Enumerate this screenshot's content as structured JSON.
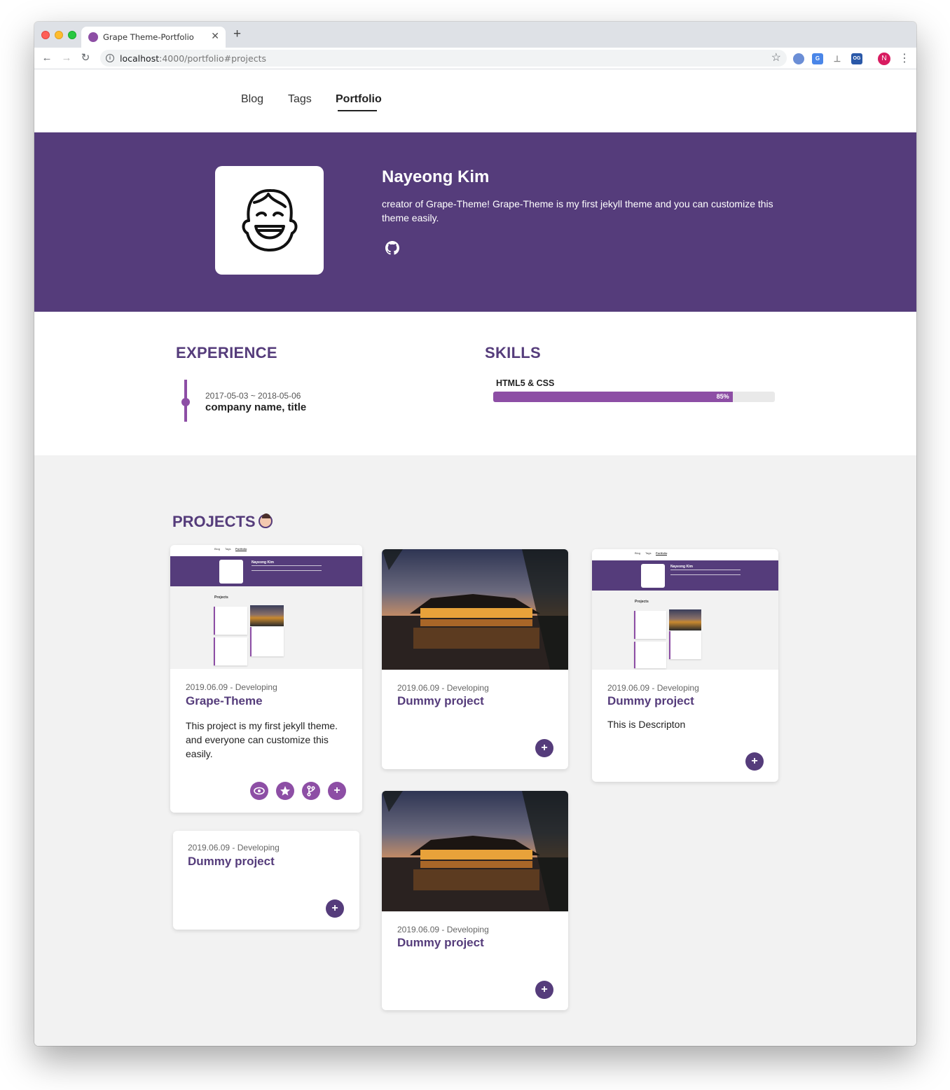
{
  "browser": {
    "tab_title": "Grape Theme-Portfolio",
    "new_tab": "+",
    "url_host": "localhost",
    "url_path": ":4000/portfolio#projects",
    "profile_initial": "N",
    "ext_og": "OG"
  },
  "nav": {
    "items": [
      {
        "label": "Blog"
      },
      {
        "label": "Tags"
      },
      {
        "label": "Portfolio"
      }
    ]
  },
  "profile": {
    "name": "Nayeong Kim",
    "bio": "creator of Grape-Theme! Grape-Theme is my first jekyll theme and you can customize this theme easily."
  },
  "experience": {
    "title": "EXPERIENCE",
    "items": [
      {
        "date": "2017-05-03 ~ 2018-05-06",
        "title": "company name, title"
      }
    ]
  },
  "skills": {
    "title": "SKILLS",
    "items": [
      {
        "name": "HTML5 & CSS",
        "percent": 85,
        "percent_label": "85%"
      }
    ]
  },
  "projects": {
    "title": "PROJECTS",
    "cards": [
      {
        "date": "2019.06.09 - Developing",
        "title": "Grape-Theme",
        "description": "This project is my first jekyll theme. and everyone can customize this easily."
      },
      {
        "date": "2019.06.09 - Developing",
        "title": "Dummy project",
        "description": ""
      },
      {
        "date": "2019.06.09 - Developing",
        "title": "Dummy project",
        "description": "This is Descripton"
      },
      {
        "date": "2019.06.09 - Developing",
        "title": "Dummy project",
        "description": ""
      },
      {
        "date": "2019.06.09 - Developing",
        "title": "Dummy project",
        "description": ""
      }
    ],
    "thumbnail": {
      "nav": [
        "Blog",
        "Tags",
        "Portfolio"
      ],
      "name": "Nayeong Kim",
      "section": "Projects"
    }
  },
  "colors": {
    "brand": "#553c7b",
    "accent": "#8d4ea5",
    "background": "#f2f2f2"
  }
}
